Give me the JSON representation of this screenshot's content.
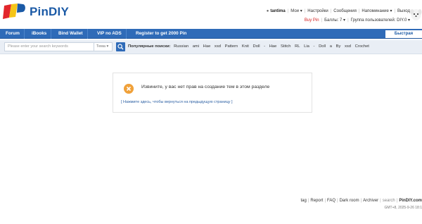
{
  "header": {
    "site_name": "PinDIY",
    "logo_colors": {
      "red": "#e2262b",
      "yellow": "#f5c518",
      "blue": "#1b5aa6"
    }
  },
  "user_menu": {
    "username": "tantima",
    "items": [
      "Мои ▾",
      "Настройки",
      "Сообщения",
      "Напоминание ▾",
      "Выход"
    ]
  },
  "user_info": {
    "buy_pin": "Buy Pin",
    "points": "Баллы: 7 ▾",
    "group": "Группа пользователей: DIY.0 ▾"
  },
  "navbar": {
    "items": [
      "Forum",
      "iBooks",
      "Bind Wallet",
      "VIP no ADS",
      "Register to get 2000 Pin"
    ],
    "right_button": "Быстрая",
    "color": "#2f6bb8"
  },
  "search": {
    "placeholder": "Please enter your search keywords",
    "type_label": "Тема ▾",
    "hot_label": "Популярные поиски:",
    "keywords": [
      "Russian",
      "ami",
      "Hae",
      "xsd",
      "Pattern",
      "Knit",
      "Doll",
      "-",
      "Hae",
      "Stitch",
      "RL",
      "Lia",
      "-",
      "Doll",
      "a",
      "By",
      "xsd",
      "Crochet"
    ]
  },
  "message": {
    "icon": "close-icon",
    "text": "Извините, у вас нет прав на создание тем в этом разделе",
    "back_link": "[ Нажмите здесь, чтобы вернуться на предыдущую страницу ]",
    "icon_color": "#f0a13a"
  },
  "footer": {
    "links": [
      "tag",
      "Report",
      "FAQ",
      "Dark room",
      "Archiver"
    ],
    "search": "search",
    "brand": "PinDIY.com",
    "time": "GMT+8, 2025-9-26 18:1"
  }
}
